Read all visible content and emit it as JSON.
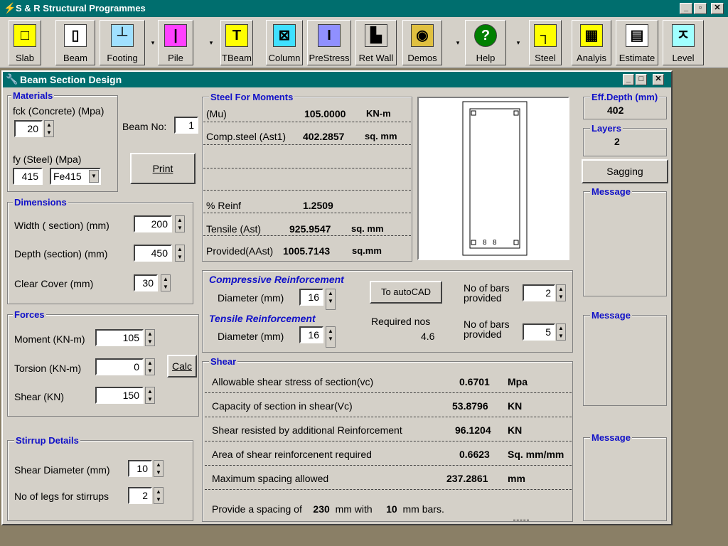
{
  "app": {
    "title": "S & R Structural Programmes"
  },
  "toolbar": [
    {
      "label": "Slab",
      "icon": "slab-icon",
      "color": "#ffff00",
      "glyph": "□"
    },
    {
      "label": "Beam",
      "icon": "beam-icon",
      "color": "#ffffff",
      "glyph": "▯"
    },
    {
      "label": "Footing",
      "icon": "footing-icon",
      "color": "#a0e0ff",
      "glyph": "┴"
    },
    {
      "label": "Pile",
      "icon": "pile-icon",
      "color": "#ff40ff",
      "glyph": "|"
    },
    {
      "label": "TBeam",
      "icon": "tbeam-icon",
      "color": "#ffff00",
      "glyph": "T"
    },
    {
      "label": "Column",
      "icon": "column-icon",
      "color": "#40e0ff",
      "glyph": "⊠"
    },
    {
      "label": "PreStress",
      "icon": "prestress-icon",
      "color": "#9090ff",
      "glyph": "I"
    },
    {
      "label": "Ret Wall",
      "icon": "ret-wall-icon",
      "color": "#d4d0c8",
      "glyph": "▙"
    },
    {
      "label": "Demos",
      "icon": "demos-icon",
      "color": "#e0c040",
      "glyph": "◉"
    },
    {
      "label": "Help",
      "icon": "help-icon",
      "color": "#008000",
      "glyph": "?"
    },
    {
      "label": "Steel",
      "icon": "steel-icon",
      "color": "#ffff00",
      "glyph": "┐"
    },
    {
      "label": "Analyis",
      "icon": "analysis-icon",
      "color": "#ffff00",
      "glyph": "▦"
    },
    {
      "label": "Estimate",
      "icon": "estimate-icon",
      "color": "#ffffff",
      "glyph": "▤"
    },
    {
      "label": "Level",
      "icon": "level-icon",
      "color": "#a0ffff",
      "glyph": "ㅈ"
    }
  ],
  "window": {
    "title": "Beam Section Design"
  },
  "materials": {
    "label": "Materials",
    "fck_label": "fck (Concrete) (Mpa)",
    "fck": "20",
    "fy_label": "fy (Steel) (Mpa)",
    "fy": "415",
    "grade": "Fe415",
    "beam_no_label": "Beam No:",
    "beam_no": "1",
    "print": "Print"
  },
  "dimensions": {
    "label": "Dimensions",
    "width_label": "Width ( section)  (mm)",
    "width": "200",
    "depth_label": "Depth (section) (mm)",
    "depth": "450",
    "cover_label": "Clear Cover (mm)",
    "cover": "30"
  },
  "forces": {
    "label": "Forces",
    "moment_label": "Moment (KN-m)",
    "moment": "105",
    "torsion_label": "Torsion (KN-m)",
    "torsion": "0",
    "shear_label": "Shear (KN)",
    "shear": "150",
    "calc": "Calc"
  },
  "stirrup": {
    "label": "Stirrup Details",
    "dia_label": "Shear Diameter (mm)",
    "dia": "10",
    "legs_label": "No of legs for stirrups",
    "legs": "2"
  },
  "steel": {
    "label": "Steel For Moments",
    "mu_label": "(Mu)",
    "mu": "105.0000",
    "mu_unit": "KN-m",
    "ast1_label": "Comp.steel (Ast1)",
    "ast1": "402.2857",
    "ast1_unit": "sq. mm",
    "reinf_label": "% Reinf",
    "reinf": "1.2509",
    "ast_label": "Tensile (Ast)",
    "ast": "925.9547",
    "ast_unit": "sq. mm",
    "aast_label": "Provided(AAst)",
    "aast": "1005.7143",
    "aast_unit": "sq.mm"
  },
  "reinforcement": {
    "comp_label": "Compressive Reinforcement",
    "comp_dia_label": "Diameter (mm)",
    "comp_dia": "16",
    "autocad": "To autoCAD",
    "comp_bars_label": "No of bars provided",
    "comp_bars": "2",
    "tens_label": "Tensile Reinforcement",
    "tens_dia_label": "Diameter (mm)",
    "tens_dia": "16",
    "req_label": "Required nos",
    "req": "4.6",
    "tens_bars_label": "No of bars provided",
    "tens_bars": "5"
  },
  "shear": {
    "label": "Shear",
    "rows": [
      {
        "label": "Allowable shear stress of section(vc)",
        "value": "0.6701",
        "unit": "Mpa"
      },
      {
        "label": "Capacity of section in shear(Vc)",
        "value": "53.8796",
        "unit": "KN"
      },
      {
        "label": "Shear resisted by additional Reinforcement",
        "value": "96.1204",
        "unit": "KN"
      },
      {
        "label": "Area of shear reinforcenent required",
        "value": "0.6623",
        "unit": "Sq. mm/mm"
      },
      {
        "label": "Maximum spacing allowed",
        "value": "237.2861",
        "unit": "mm"
      }
    ],
    "provide_prefix": "Provide a spacing of",
    "spacing": "230",
    "mid": "mm with",
    "bar": "10",
    "suffix": "mm bars."
  },
  "right": {
    "eff_label": "Eff.Depth (mm)",
    "eff": "402",
    "layers_label": "Layers",
    "layers": "2",
    "sagging": "Sagging",
    "message": "Message"
  }
}
